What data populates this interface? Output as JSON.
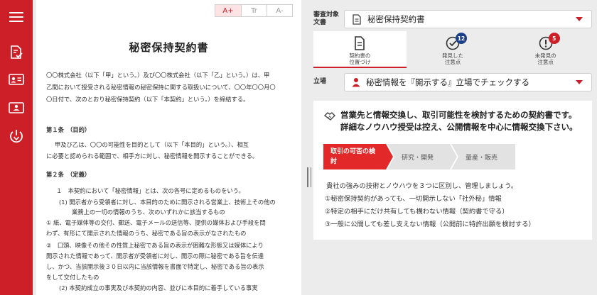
{
  "toolbar": {
    "font_large": "A+",
    "font_normal": "Tr",
    "font_small": "A-"
  },
  "document": {
    "title": "秘密保持契約書",
    "intro": [
      "〇〇株式会社（以下「甲」という。）及び〇〇株式会社（以下「乙」という。）は、甲",
      "乙間において授受される秘密情報の秘密保持に関する取扱いについて、〇〇年〇〇月〇",
      "〇日付で、次のとおり秘密保持契約（以下「本契約」という。）を締結する。"
    ],
    "art1_heading": "第１条　（目的）",
    "art1_lines": [
      "甲及び乙は、〇〇の可能性を目的として（以下「本目的」という。）、相互",
      "に必要と認められる範囲で、相手方に対し、秘密情報を開示することができる。"
    ],
    "art2_heading": "第２条　（定義）",
    "art2_lines": [
      "１　本契約において「秘密情報」とは、次の各号に定めるものをいう。",
      "(1) 開示者から受領者に対し、本目的のために開示される営業上、技術上その他の",
      "業務上の一切の情報のうち、次のいずれかに該当するもの",
      "① 紙、電子媒体等の交付、郵送、電子メールの送信等、提供の媒体および手段を問",
      "わず、有形にて開示された情報のうち、秘密である旨の表示がなされたもの",
      "②　口頭、映像その他その性質上秘密である旨の表示が困難な形態又は媒体により",
      "開示された情報であって、開示者が受領者に対し、開示の際に秘密である旨を伝達",
      "し、かつ、当該開示後３０日以内に当該情報を書面で特定し、秘密である旨の表示",
      "をして交付したもの",
      "(2) 本契約成立の事実及び本契約の内容、並びに本目的に着手している事実"
    ]
  },
  "review": {
    "target_label": "審査対象\n文書",
    "target_value": "秘密保持契約書",
    "tabs": [
      {
        "label": "契約書の\n位置づけ",
        "badge": "",
        "icon": "document-icon"
      },
      {
        "label": "発見した\n注意点",
        "badge": "12",
        "icon": "check-circle-icon",
        "badge_color": "#1c3f8c"
      },
      {
        "label": "未発見の\n注意点",
        "badge": "5",
        "icon": "exclamation-circle-icon",
        "badge_color": "#cc1f27"
      }
    ],
    "position_label": "立場",
    "position_value": "秘密情報を『開示する』立場でチェックする",
    "card": {
      "headline_1": "営業先と情報交換し、取引可能性を検討するための契約書です。",
      "headline_2": "詳細なノウハウ授受は控え、公開情報を中心に情報交換下さい。",
      "steps": [
        "取引の可否の検\n討",
        "研究・開発",
        "量産・販売"
      ],
      "body": [
        "貴社の強みの技術とノウハウを３つに区別し、管理しましょう。",
        "①秘密保持契約があっても、一切開示しない「社外秘」情報",
        "②特定の相手にだけ共有しても構わない情報（契約書で守る）",
        "③一般に公開しても差し支えない情報（公開前に特許出願を検討する）"
      ]
    }
  },
  "colors": {
    "brand": "#cc1f27",
    "accent_blue": "#1c3f8c"
  }
}
